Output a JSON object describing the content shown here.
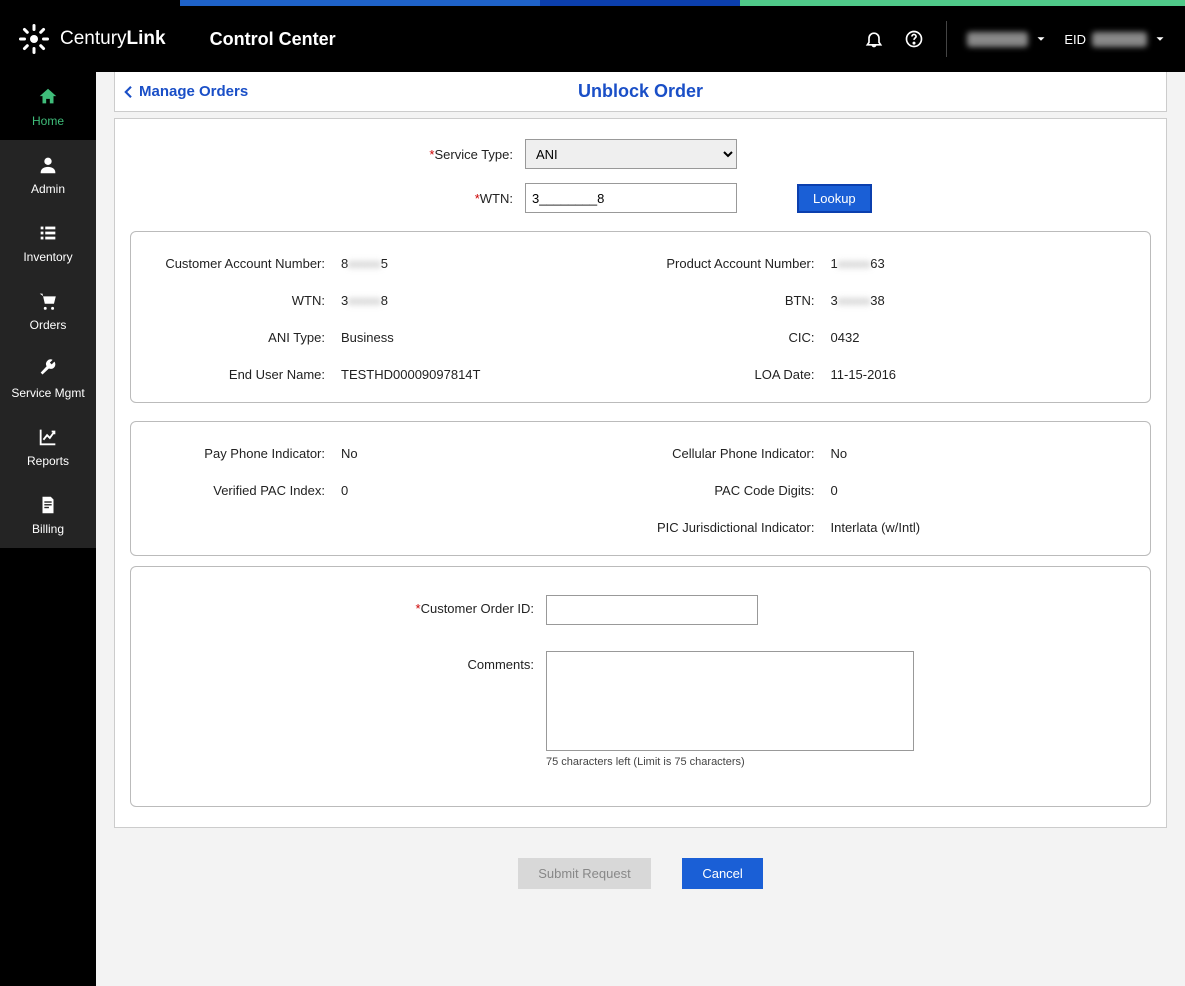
{
  "brand": {
    "name_thin": "Century",
    "name_bold": "Link"
  },
  "app_title": "Control Center",
  "user_menu": {
    "eid_label": "EID"
  },
  "sidebar": {
    "items": [
      {
        "label": "Home"
      },
      {
        "label": "Admin"
      },
      {
        "label": "Inventory"
      },
      {
        "label": "Orders"
      },
      {
        "label": "Service Mgmt"
      },
      {
        "label": "Reports"
      },
      {
        "label": "Billing"
      }
    ]
  },
  "page": {
    "back_label": "Manage Orders",
    "title": "Unblock Order"
  },
  "form": {
    "service_type_label": "Service Type:",
    "service_type_value": "ANI",
    "wtn_label": "WTN:",
    "wtn_value": "3________8",
    "lookup_label": "Lookup"
  },
  "info1": {
    "left": [
      {
        "label": "Customer Account Number:",
        "value": "8______5"
      },
      {
        "label": "WTN:",
        "value": "3______8"
      },
      {
        "label": "ANI Type:",
        "value": "Business"
      },
      {
        "label": "End User Name:",
        "value": "TESTHD00009097814T"
      }
    ],
    "right": [
      {
        "label": "Product Account Number:",
        "value": "1______63"
      },
      {
        "label": "BTN:",
        "value": "3______38"
      },
      {
        "label": "CIC:",
        "value": "0432"
      },
      {
        "label": "LOA Date:",
        "value": "11-15-2016"
      }
    ]
  },
  "info2": {
    "left": [
      {
        "label": "Pay Phone Indicator:",
        "value": "No"
      },
      {
        "label": "Verified PAC Index:",
        "value": "0"
      }
    ],
    "right": [
      {
        "label": "Cellular Phone Indicator:",
        "value": "No"
      },
      {
        "label": "PAC Code Digits:",
        "value": "0"
      },
      {
        "label": "PIC Jurisdictional Indicator:",
        "value": "Interlata (w/Intl)"
      }
    ]
  },
  "entry": {
    "coid_label": "Customer Order ID:",
    "coid_value": "",
    "comments_label": "Comments:",
    "comments_value": "",
    "hint": "75 characters left (Limit is 75 characters)"
  },
  "actions": {
    "submit_label": "Submit Request",
    "cancel_label": "Cancel"
  }
}
